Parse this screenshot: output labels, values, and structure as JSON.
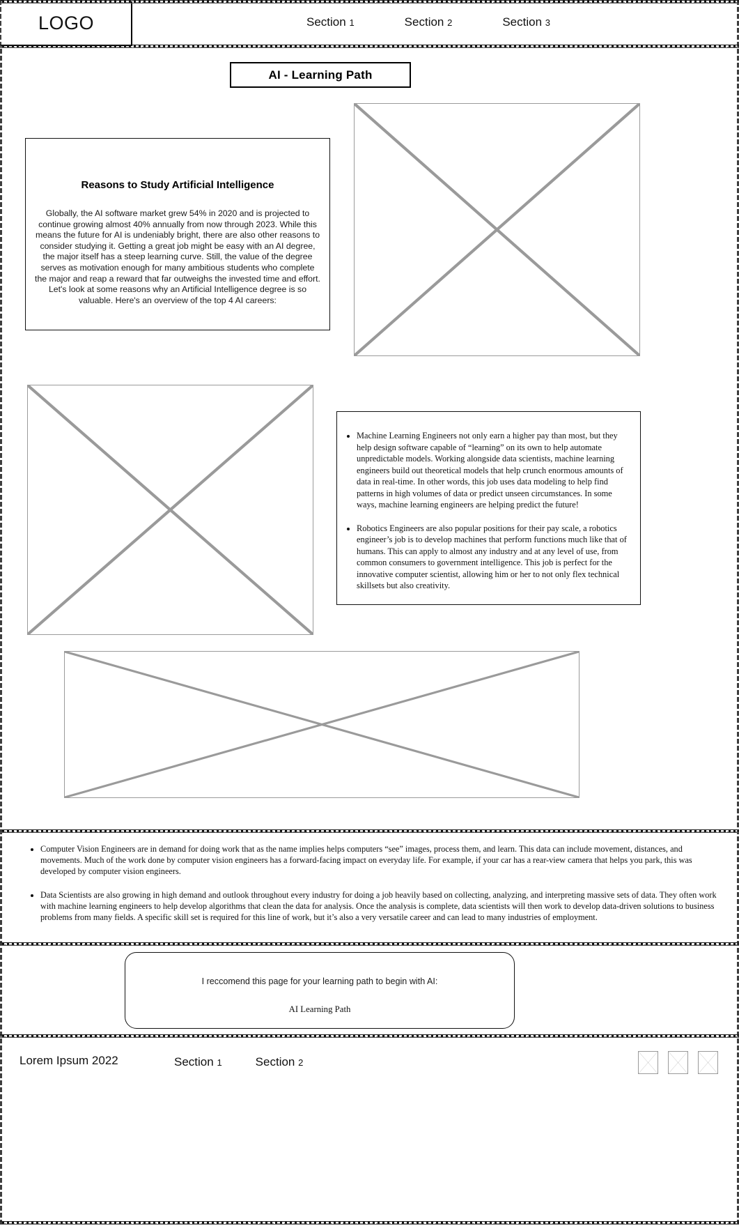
{
  "header": {
    "logo": "LOGO",
    "nav": [
      {
        "label": "Section",
        "num": "1"
      },
      {
        "label": "Section",
        "num": "2"
      },
      {
        "label": "Section",
        "num": "3"
      }
    ]
  },
  "title": {
    "text": "AI - Learning Path"
  },
  "reasons": {
    "heading": "Reasons to Study Artificial Intelligence",
    "paragraph": "Globally, the AI software market grew 54% in 2020 and is projected to continue growing almost 40% annually from now through 2023. While this means the future for AI is undeniably bright, there are also other reasons to consider studying it. Getting a great job might be easy with an AI degree, the major itself has a steep learning curve. Still, the value of the degree serves as motivation enough for many ambitious students who complete the major and reap a reward that far outweighs the invested time and effort. Let's look at some reasons why an Artificial Intelligence degree is so valuable. Here's an overview of the top 4 AI careers:"
  },
  "images": {
    "top_right": "image-placeholder",
    "mid_left": "image-placeholder",
    "bottom_wide": "image-placeholder"
  },
  "careers_upper": {
    "bullets": [
      "Machine Learning Engineers not only earn a higher pay than most, but they help design software capable of “learning” on its own to help automate unpredictable models. Working alongside data scientists, machine learning engineers build out theoretical models that help crunch enormous amounts of data in real-time. In other words, this job uses data modeling to help find patterns in high volumes of data or predict unseen circumstances. In some ways, machine learning engineers are helping predict the future!",
      "Robotics Engineers are also popular positions for their pay scale, a robotics engineer’s job is to develop machines that perform functions much like that of humans. This can apply to almost any industry and at any level of use, from common consumers to government intelligence. This job is perfect for the innovative computer scientist, allowing him or her to not only flex technical skillsets but also creativity."
    ]
  },
  "careers_lower": {
    "bullets": [
      "Computer Vision Engineers are in demand for doing work that as the name implies helps computers “see” images, process them, and learn. This data can include movement, distances, and movements. Much of the work done by computer vision engineers has a forward-facing impact on everyday life. For example, if your car has a rear-view camera that helps you park, this was developed by computer vision engineers.",
      "Data Scientists are also growing in high demand and outlook throughout every industry for doing a job heavily based on collecting, analyzing, and interpreting massive sets of data. They often work with machine learning engineers to help develop algorithms that clean the data for analysis. Once the analysis is complete, data scientists will then work to develop data-driven solutions to business problems from many fields. A specific skill set is required for this line of work, but it’s also a very versatile career and can lead to many industries of employment."
    ]
  },
  "recommend": {
    "intro": "I reccomend this page for your learning path to begin with AI:",
    "link_label": "AI Learning Path"
  },
  "footer": {
    "copyright": "Lorem Ipsum 2022",
    "nav": [
      {
        "label": "Section",
        "num": "1"
      },
      {
        "label": "Section",
        "num": "2"
      }
    ],
    "social": [
      "social-icon-1",
      "social-icon-2",
      "social-icon-3"
    ]
  },
  "colors": {
    "ink": "#111111",
    "placeholder_stroke": "#9a9a9a",
    "page_bg": "#ffffff"
  }
}
